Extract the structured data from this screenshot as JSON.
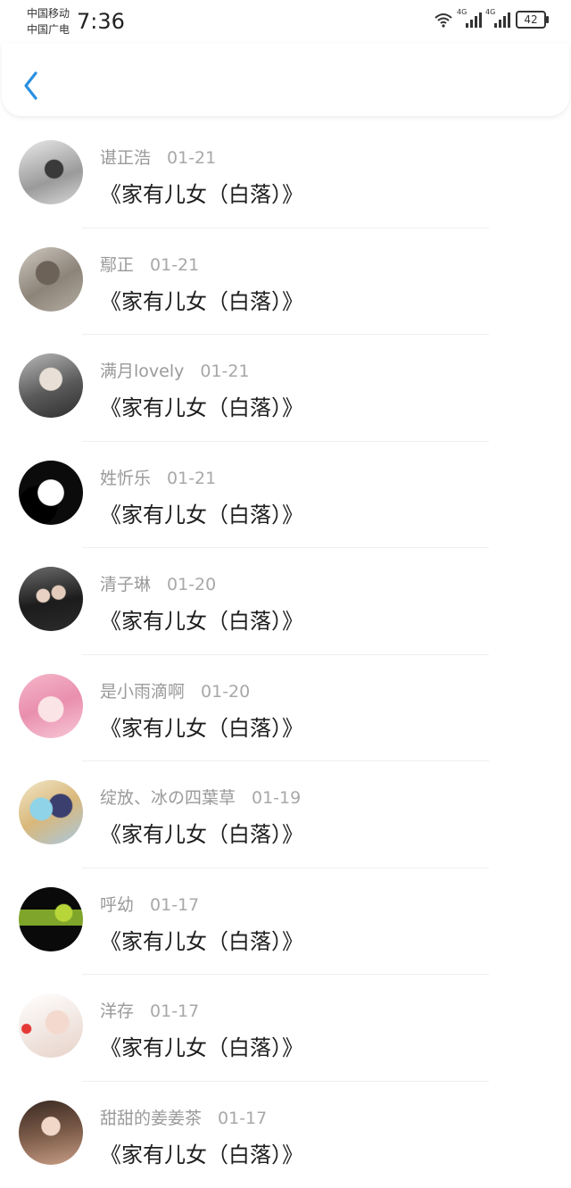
{
  "status_bar": {
    "carrier_1": "中国移动",
    "carrier_2": "中国广电",
    "time": "7:36",
    "signal_1_label": "4G",
    "signal_2_label": "4G",
    "battery": "42"
  },
  "header": {
    "back_icon": "chevron-left-icon",
    "accent_color": "#2a8fe0"
  },
  "items": [
    {
      "name": "谌正浩",
      "date": "01-21",
      "title": "《家有儿女（白落）》"
    },
    {
      "name": "鄢正",
      "date": "01-21",
      "title": "《家有儿女（白落）》"
    },
    {
      "name": "满月lovely",
      "date": "01-21",
      "title": "《家有儿女（白落）》"
    },
    {
      "name": "姓忻乐",
      "date": "01-21",
      "title": "《家有儿女（白落）》"
    },
    {
      "name": "清子琳",
      "date": "01-20",
      "title": "《家有儿女（白落）》"
    },
    {
      "name": "是小雨滴啊",
      "date": "01-20",
      "title": "《家有儿女（白落）》"
    },
    {
      "name": "绽放、冰の四葉草",
      "date": "01-19",
      "title": "《家有儿女（白落）》"
    },
    {
      "name": "呼幼",
      "date": "01-17",
      "title": "《家有儿女（白落）》"
    },
    {
      "name": "洋存",
      "date": "01-17",
      "title": "《家有儿女（白落）》"
    },
    {
      "name": "甜甜的姜姜茶",
      "date": "01-17",
      "title": "《家有儿女（白落）》"
    }
  ]
}
